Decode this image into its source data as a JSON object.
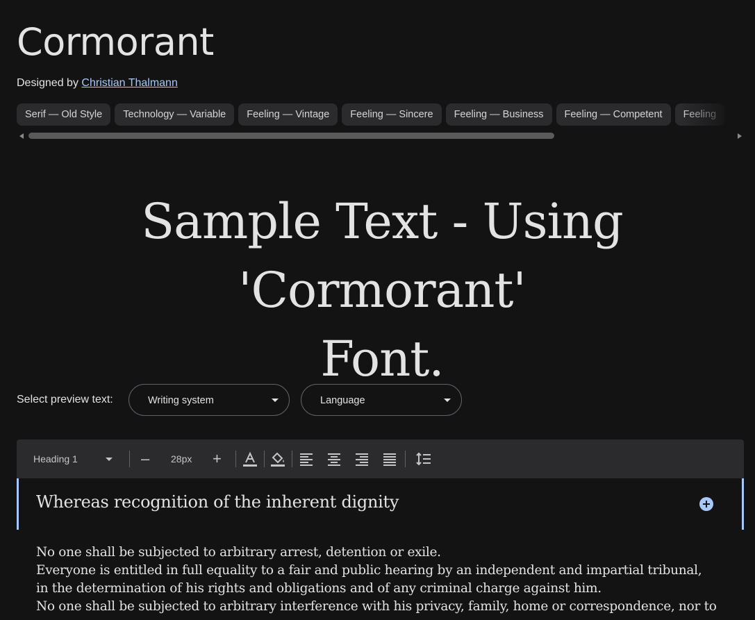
{
  "font": {
    "name": "Cormorant",
    "designed_by_label": "Designed by",
    "designer": "Christian Thalmann"
  },
  "tags": [
    "Serif — Old Style",
    "Technology — Variable",
    "Feeling — Vintage",
    "Feeling — Sincere",
    "Feeling — Business",
    "Feeling — Competent",
    "Feeling"
  ],
  "sample": {
    "line1": "Sample Text - Using 'Cormorant'",
    "line2": "Font."
  },
  "preview": {
    "label": "Select preview text:",
    "writing_system": "Writing system",
    "language": "Language"
  },
  "toolbar": {
    "style": "Heading 1",
    "minus": "–",
    "size": "28px",
    "plus": "+"
  },
  "editor": {
    "heading": "Whereas recognition of the inherent dignity",
    "lines": [
      "No one shall be subjected to arbitrary arrest, detention or exile.",
      "Everyone is entitled in full equality to a fair and public hearing by an independent and impartial tribunal,",
      "in the determination of his rights and obligations and of any criminal charge against him.",
      "No one shall be subjected to arbitrary interference with his privacy, family, home or correspondence, nor to"
    ]
  },
  "colors": {
    "background": "#131314",
    "accent": "#a8c7fa",
    "chip": "#2b2b2d"
  }
}
